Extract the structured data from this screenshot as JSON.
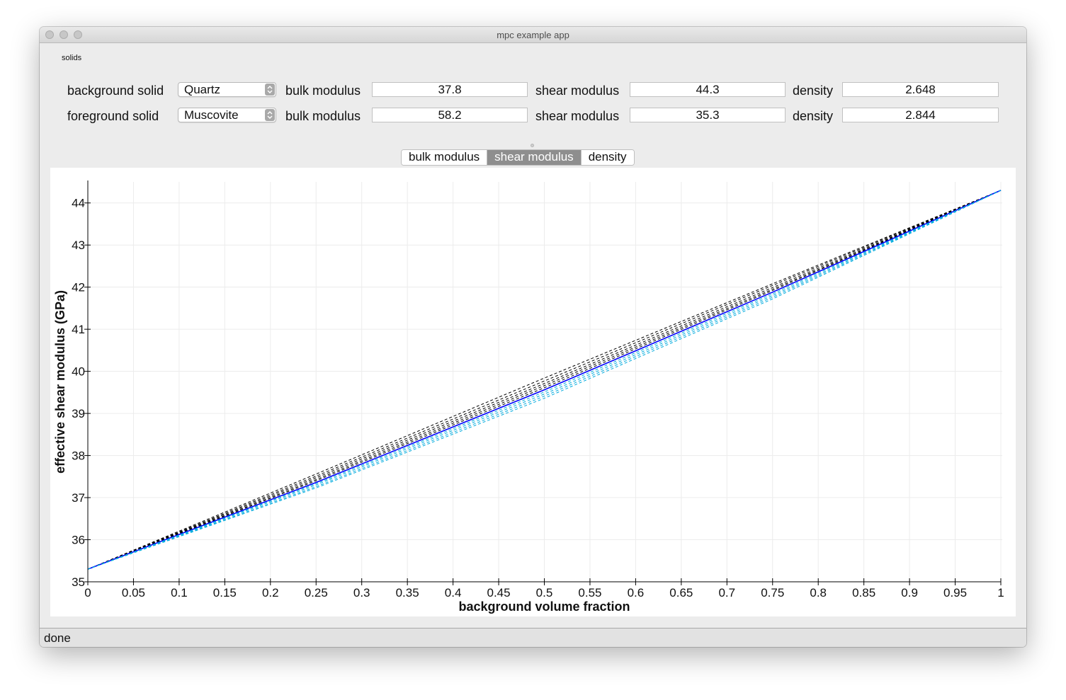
{
  "window": {
    "title": "mpc example app"
  },
  "group": {
    "label": "solids"
  },
  "background_row": {
    "label": "background solid",
    "solid": "Quartz",
    "bulk_label": "bulk modulus",
    "bulk": "37.8",
    "shear_label": "shear modulus",
    "shear": "44.3",
    "density_label": "density",
    "density": "2.648"
  },
  "foreground_row": {
    "label": "foreground solid",
    "solid": "Muscovite",
    "bulk_label": "bulk modulus",
    "bulk": "58.2",
    "shear_label": "shear modulus",
    "shear": "35.3",
    "density_label": "density",
    "density": "2.844"
  },
  "tabs": [
    {
      "label": "bulk modulus",
      "active": false
    },
    {
      "label": "shear modulus",
      "active": true
    },
    {
      "label": "density",
      "active": false
    }
  ],
  "status": {
    "text": "done"
  },
  "colors": {
    "upper_bounds": "#000000",
    "lower_bounds": "#00aadd",
    "estimate": "#0000ff"
  },
  "chart_data": {
    "type": "line",
    "xlabel": "background volume fraction",
    "ylabel": "effective shear modulus (GPa)",
    "xlim": [
      0,
      1
    ],
    "ylim": [
      35,
      44.5
    ],
    "grid": true,
    "x_ticks": [
      "0",
      "0.05",
      "0.1",
      "0.15",
      "0.2",
      "0.25",
      "0.3",
      "0.35",
      "0.4",
      "0.45",
      "0.5",
      "0.55",
      "0.6",
      "0.65",
      "0.7",
      "0.75",
      "0.8",
      "0.85",
      "0.9",
      "0.95",
      "1"
    ],
    "y_ticks": [
      "35",
      "36",
      "37",
      "38",
      "39",
      "40",
      "41",
      "42",
      "43",
      "44"
    ],
    "x": [
      0,
      0.25,
      0.5,
      0.75,
      1
    ],
    "series": [
      {
        "style": "dashed",
        "color": "#000000",
        "values": [
          35.3,
          37.56,
          39.84,
          42.08,
          44.3
        ]
      },
      {
        "style": "dashed",
        "color": "#000000",
        "values": [
          35.3,
          37.51,
          39.77,
          42.04,
          44.3
        ]
      },
      {
        "style": "dashed",
        "color": "#000000",
        "values": [
          35.3,
          37.47,
          39.71,
          41.99,
          44.3
        ]
      },
      {
        "style": "dashed",
        "color": "#000000",
        "values": [
          35.3,
          37.43,
          39.66,
          41.95,
          44.3
        ]
      },
      {
        "style": "dashed",
        "color": "#000000",
        "values": [
          35.3,
          37.4,
          39.61,
          41.92,
          44.3
        ]
      },
      {
        "style": "solid",
        "color": "#0000ff",
        "values": [
          35.3,
          37.36,
          39.56,
          41.88,
          44.3
        ]
      },
      {
        "style": "dashed",
        "color": "#00aadd",
        "values": [
          35.3,
          37.33,
          39.51,
          41.84,
          44.3
        ]
      },
      {
        "style": "dashed",
        "color": "#00aadd",
        "values": [
          35.3,
          37.3,
          39.46,
          41.8,
          44.3
        ]
      },
      {
        "style": "dashed",
        "color": "#00aadd",
        "values": [
          35.3,
          37.26,
          39.41,
          41.76,
          44.3
        ]
      },
      {
        "style": "dashed",
        "color": "#00aadd",
        "values": [
          35.3,
          37.23,
          39.36,
          41.72,
          44.3
        ]
      }
    ]
  }
}
